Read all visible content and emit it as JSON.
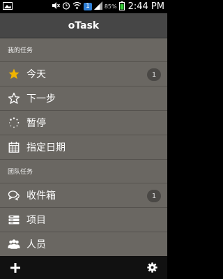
{
  "status_bar": {
    "notification_badge": "1",
    "battery_percent": "85%",
    "time": "2:44 PM"
  },
  "app_bar": {
    "title": "oTask"
  },
  "sections": [
    {
      "header": "我的任务",
      "items": [
        {
          "label": "今天",
          "icon": "star-filled-icon",
          "count": "1"
        },
        {
          "label": "下一步",
          "icon": "star-outline-icon"
        },
        {
          "label": "暂停",
          "icon": "spinner-dots-icon"
        },
        {
          "label": "指定日期",
          "icon": "calendar-icon"
        }
      ]
    },
    {
      "header": "团队任务",
      "items": [
        {
          "label": "收件箱",
          "icon": "chat-bubbles-icon",
          "count": "1"
        },
        {
          "label": "项目",
          "icon": "stack-icon"
        },
        {
          "label": "人员",
          "icon": "people-icon"
        }
      ]
    }
  ],
  "bottom_bar": {
    "add_icon": "plus-icon",
    "settings_icon": "gear-icon"
  },
  "colors": {
    "drawer_bg": "#6a6762",
    "app_bar_bg": "#464646",
    "star_accent": "#f0b400",
    "badge_bg": "#4a4845"
  }
}
